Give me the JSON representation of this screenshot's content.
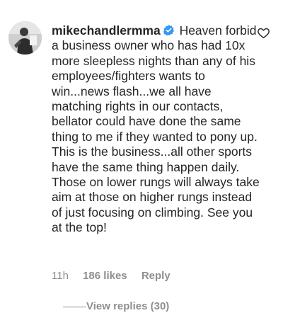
{
  "comment": {
    "username": "mikechandlermma",
    "verified_icon": "verified-badge-icon",
    "text": "Heaven forbid a business owner who has had 10x more sleepless nights than any of his employees/fighters wants to win...news flash...we all have matching rights in our contacts, bellator could have done the same thing to me if they wanted to pony up. This is the business...all other sports have the same thing happen daily. Those on lower rungs will always take aim at those on higher rungs instead of just focusing on climbing. See you at the top!",
    "time": "11h",
    "likes": "186 likes",
    "reply_label": "Reply",
    "like_icon": "heart-outline-icon",
    "avatar_icon": "profile-photo"
  },
  "replies": {
    "label": "View replies (30)"
  },
  "colors": {
    "text": "#262626",
    "secondary": "#8e8e8e",
    "verified": "#3897f0"
  }
}
